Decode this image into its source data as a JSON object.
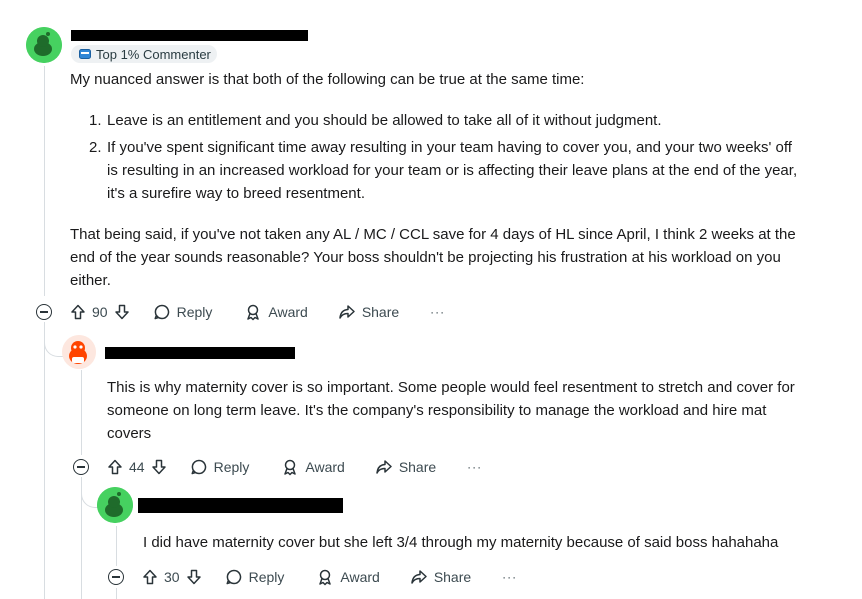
{
  "comment1": {
    "badge": "Top 1% Commenter",
    "intro": "My nuanced answer is that both of the following can be true at the same time:",
    "points": [
      {
        "num": "1.",
        "lines": [
          "Leave is an entitlement and you should be allowed to take all of it without judgment."
        ]
      },
      {
        "num": "2.",
        "lines": [
          "If you've spent significant time away resulting in your team having to cover you, and your two weeks' off",
          "is resulting in an increased workload for your team or is affecting their leave plans at the end of the year,",
          "it's a surefire way to breed resentment."
        ]
      }
    ],
    "closing": [
      "That being said, if you've not taken any AL / MC / CCL save for 4 days of HL since April, I think 2 weeks at the",
      "end of the year sounds reasonable? Your boss shouldn't be projecting his frustration at his workload on you",
      "either."
    ],
    "votes": "90",
    "reply": "Reply",
    "award": "Award",
    "share": "Share",
    "more": "···"
  },
  "comment2": {
    "lines": [
      "This is why maternity cover is so important. Some people would feel resentment to stretch and cover for",
      "someone on long term leave. It's the company's responsibility to manage the workload and hire mat",
      "covers"
    ],
    "votes": "44",
    "reply": "Reply",
    "award": "Award",
    "share": "Share",
    "more": "···"
  },
  "comment3": {
    "text": "I did have maternity cover but she left 3/4 through my maternity because of said boss hahahaha",
    "votes": "30",
    "reply": "Reply",
    "award": "Award",
    "share": "Share",
    "more": "···"
  },
  "colors": {
    "avatar_green": "#46d160",
    "avatar_orange": "#ff4500",
    "redaction": "#000000"
  },
  "icons": [
    "snoo-avatar",
    "badge-icon",
    "collapse-icon",
    "upvote-icon",
    "downvote-icon",
    "reply-icon",
    "award-icon",
    "share-icon",
    "more-icon"
  ]
}
